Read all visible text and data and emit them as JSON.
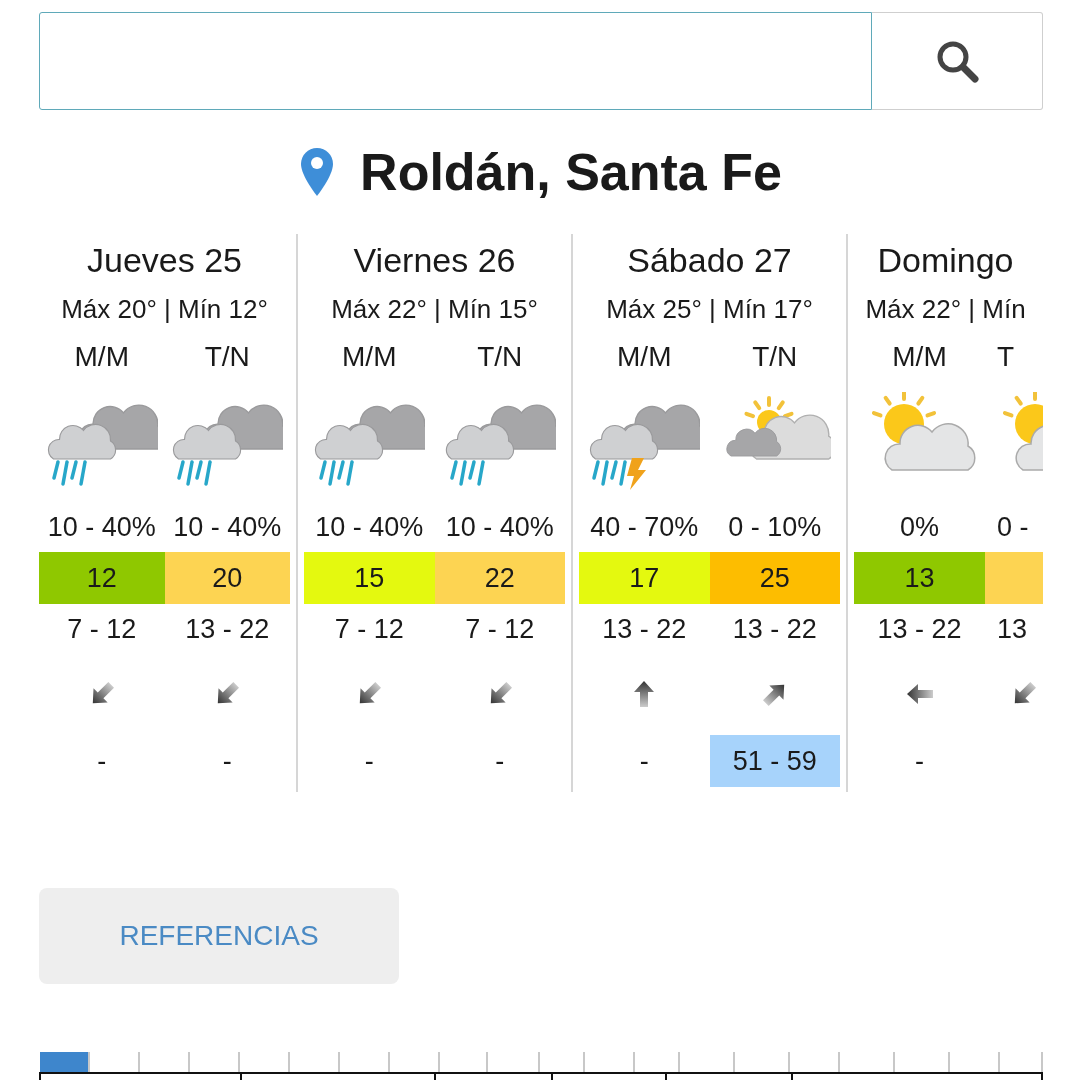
{
  "location": "Roldán, Santa Fe",
  "days": [
    {
      "title": "Jueves 25",
      "temps": "Máx 20° | Mín 12°",
      "cut_off": false,
      "periods": [
        {
          "label": "M/M",
          "weather": {
            "kind": "rain"
          },
          "rain": "10 - 40%",
          "index": {
            "value": "12",
            "color": "#8fc800"
          },
          "range": "7 - 12",
          "wind": {
            "kind": "sw"
          },
          "gust": {
            "text": "-"
          }
        },
        {
          "label": "T/N",
          "weather": {
            "kind": "rain"
          },
          "rain": "10 - 40%",
          "index": {
            "value": "20",
            "color": "#fdd452"
          },
          "range": "13 - 22",
          "wind": {
            "kind": "sw"
          },
          "gust": {
            "text": "-"
          }
        }
      ]
    },
    {
      "title": "Viernes 26",
      "temps": "Máx 22° | Mín 15°",
      "cut_off": false,
      "periods": [
        {
          "label": "M/M",
          "weather": {
            "kind": "rain"
          },
          "rain": "10 - 40%",
          "index": {
            "value": "15",
            "color": "#e4f90f"
          },
          "range": "7 - 12",
          "wind": {
            "kind": "sw"
          },
          "gust": {
            "text": "-"
          }
        },
        {
          "label": "T/N",
          "weather": {
            "kind": "rain"
          },
          "rain": "10 - 40%",
          "index": {
            "value": "22",
            "color": "#fdd452"
          },
          "range": "7 - 12",
          "wind": {
            "kind": "sw"
          },
          "gust": {
            "text": "-"
          }
        }
      ]
    },
    {
      "title": "Sábado 27",
      "temps": "Máx 25° | Mín 17°",
      "cut_off": false,
      "periods": [
        {
          "label": "M/M",
          "weather": {
            "kind": "storm"
          },
          "rain": "40 - 70%",
          "index": {
            "value": "17",
            "color": "#e4f90f"
          },
          "range": "13 - 22",
          "wind": {
            "kind": "n"
          },
          "gust": {
            "text": "-"
          }
        },
        {
          "label": "T/N",
          "weather": {
            "kind": "cloudy"
          },
          "rain": "0 - 10%",
          "index": {
            "value": "25",
            "color": "#fdbd00"
          },
          "range": "13 - 22",
          "wind": {
            "kind": "ne"
          },
          "gust": {
            "text": "51 - 59",
            "color": "#a7d3fb"
          }
        }
      ]
    },
    {
      "title": "Domingo",
      "temps": "Máx 22° | Mín",
      "cut_off": true,
      "periods": [
        {
          "label": "M/M",
          "weather": {
            "kind": "sunny"
          },
          "rain": "0%",
          "index": {
            "value": "13",
            "color": "#8fc800"
          },
          "range": "13 - 22",
          "wind": {
            "kind": "w"
          },
          "gust": {
            "text": "-"
          }
        },
        {
          "label": "T",
          "weather": {
            "kind": "sunny"
          },
          "rain": "0 -",
          "index": {
            "color": "#fdd452"
          },
          "range": "13",
          "wind": {
            "kind": "sw"
          }
        }
      ]
    }
  ],
  "references_button": "REFERENCIAS"
}
